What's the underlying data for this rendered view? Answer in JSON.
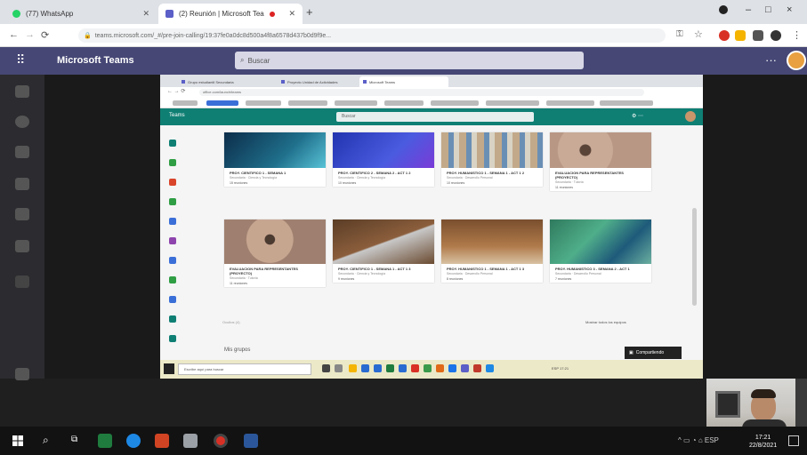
{
  "browser": {
    "tabs": [
      {
        "title": "(77) WhatsApp",
        "active": false
      },
      {
        "title": "(2) Reunión | Microsoft Tea",
        "active": true
      }
    ],
    "new_tab": "+",
    "controls": {
      "minimize": "–",
      "maximize": "□",
      "close": "×"
    },
    "url": "teams.microsoft.com/_#/pre-join-calling/19:37fe0a0dc8d500a4f8a6578d437b0d9f9e..."
  },
  "teams": {
    "app_title": "Microsoft Teams",
    "search_placeholder": "Buscar",
    "more": "···"
  },
  "shared": {
    "in_tabs": [
      {
        "title": "Grupo estudiantil Secundaria",
        "active": false
      },
      {
        "title": "Proyecto Unidad de Actividades",
        "active": false
      },
      {
        "title": "Microsoft Teams",
        "active": true
      }
    ],
    "in_url": "office.com/launch/teams",
    "teams_label": "Teams",
    "search": "Buscar",
    "cards_row1": [
      {
        "title": "PROY. CIENTIFICO 1 - SEMANA 1",
        "sub": "Secundaria · Ciencia y Tecnología",
        "status": "15 reuniones"
      },
      {
        "title": "PROY. CIENTIFICO 2 - SEMANA 2 - ACT 1 2",
        "sub": "Secundaria · Ciencia y Tecnología",
        "status": "10 reuniones"
      },
      {
        "title": "PROY. HUMANISTICO 1 - SEMANA 1 - ACT 1 2",
        "sub": "Secundaria · Desarrollo Personal",
        "status": "10 reuniones"
      },
      {
        "title": "EVALUACION PARA REPRESENTANTES (PROYECTO)",
        "sub": "Secundaria · Tutoría",
        "status": "11 reuniones"
      }
    ],
    "cards_row2": [
      {
        "title": "EVALUACION PARA REPRESENTANTES (PROYECTO)",
        "sub": "Secundaria · Tutoría",
        "status": "11 reuniones"
      },
      {
        "title": "PROY. CIENTIFICO 1 - SEMANA 1 - ACT 1 3",
        "sub": "Secundaria · Ciencia y Tecnología",
        "status": "9 reuniones"
      },
      {
        "title": "PROY. HUMANISTICO 1 - SEMANA 1 - ACT 1 3",
        "sub": "Secundaria · Desarrollo Personal",
        "status": "8 reuniones"
      },
      {
        "title": "PROY. HUMANISTICO 3 - SEMANA 2 - ACT 1",
        "sub": "Secundaria · Desarrollo Personal",
        "status": "7 reuniones"
      }
    ],
    "filter_label": "Ocultos (4)",
    "show_all": "Mostrar todos los equipos",
    "section": "Mis grupos",
    "present_label": "Compartiendo",
    "taskbar_search": "Escribe aquí para buscar",
    "tray": "ESP 17:21"
  },
  "windows": {
    "tray": "ESP",
    "clock_time": "17:21",
    "clock_date": "22/8/2021"
  }
}
